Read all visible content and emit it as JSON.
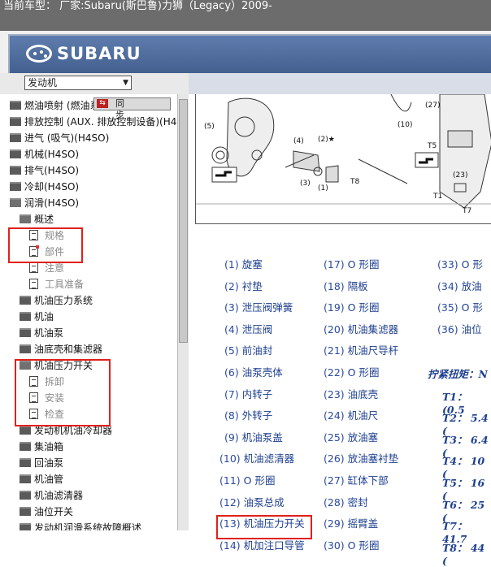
{
  "header": {
    "text": "当前车型：  厂家:Subaru(斯巴鲁)力狮（Legacy）2009-"
  },
  "banner": {
    "logo_text": "SUBARU"
  },
  "left": {
    "select_value": "发动机",
    "sync_label": "同 步",
    "tree": [
      {
        "label": "燃油喷射 (燃油系统)(H4SO)",
        "type": "folder",
        "indent": 0
      },
      {
        "label": "排放控制 (AUX. 排放控制设备)(H4SO)",
        "type": "folder",
        "indent": 0
      },
      {
        "label": "进气 (吸气)(H4SO)",
        "type": "folder",
        "indent": 0
      },
      {
        "label": "机械(H4SO)",
        "type": "folder",
        "indent": 0
      },
      {
        "label": "排气(H4SO)",
        "type": "folder",
        "indent": 0
      },
      {
        "label": "冷却(H4SO)",
        "type": "folder",
        "indent": 0
      },
      {
        "label": "润滑(H4SO)",
        "type": "folder-open",
        "indent": 0
      },
      {
        "label": "概述",
        "type": "folder-open",
        "indent": 1
      },
      {
        "label": "规格",
        "type": "doc",
        "indent": 2
      },
      {
        "label": "部件",
        "type": "doc-red",
        "indent": 2
      },
      {
        "label": "注意",
        "type": "doc",
        "indent": 2
      },
      {
        "label": "工具准备",
        "type": "doc",
        "indent": 2
      },
      {
        "label": "机油压力系统",
        "type": "folder",
        "indent": 1
      },
      {
        "label": "机油",
        "type": "folder",
        "indent": 1
      },
      {
        "label": "机油泵",
        "type": "folder",
        "indent": 1
      },
      {
        "label": "油底壳和集滤器",
        "type": "folder",
        "indent": 1
      },
      {
        "label": "机油压力开关",
        "type": "folder-open",
        "indent": 1
      },
      {
        "label": "拆卸",
        "type": "doc",
        "indent": 2
      },
      {
        "label": "安装",
        "type": "doc",
        "indent": 2
      },
      {
        "label": "检查",
        "type": "doc",
        "indent": 2
      },
      {
        "label": "发动机机油冷却器",
        "type": "folder",
        "indent": 1
      },
      {
        "label": "集油箱",
        "type": "folder",
        "indent": 1
      },
      {
        "label": "回油泵",
        "type": "folder",
        "indent": 1
      },
      {
        "label": "机油管",
        "type": "folder",
        "indent": 1
      },
      {
        "label": "机油滤清器",
        "type": "folder",
        "indent": 1
      },
      {
        "label": "油位开关",
        "type": "folder",
        "indent": 1
      },
      {
        "label": "发动机润滑系统故障概述",
        "type": "folder",
        "indent": 1
      }
    ]
  },
  "diagram": {
    "labels": [
      "(5)",
      "(4)",
      "(2)★",
      "(3)",
      "(1)",
      "T8",
      "(10)",
      "(27)",
      "T5",
      "(23)",
      "T1",
      "T7"
    ]
  },
  "legend": {
    "col1": [
      {
        "n": "(1)",
        "t": "旋塞"
      },
      {
        "n": "(2)",
        "t": "衬垫"
      },
      {
        "n": "(3)",
        "t": "泄压阀弹簧"
      },
      {
        "n": "(4)",
        "t": "泄压阀"
      },
      {
        "n": "(5)",
        "t": "前油封"
      },
      {
        "n": "(6)",
        "t": "油泵壳体"
      },
      {
        "n": "(7)",
        "t": "内转子"
      },
      {
        "n": "(8)",
        "t": "外转子"
      },
      {
        "n": "(9)",
        "t": "机油泵盖"
      },
      {
        "n": "(10)",
        "t": "机油滤清器"
      },
      {
        "n": "(11)",
        "t": "O 形圈"
      },
      {
        "n": "(12)",
        "t": "油泵总成"
      },
      {
        "n": "(13)",
        "t": "机油压力开关"
      },
      {
        "n": "(14)",
        "t": "机加注口导管"
      }
    ],
    "col2": [
      {
        "n": "(17)",
        "t": "O 形圈"
      },
      {
        "n": "(18)",
        "t": "隔板"
      },
      {
        "n": "(19)",
        "t": "O 形圈"
      },
      {
        "n": "(20)",
        "t": "机油集滤器"
      },
      {
        "n": "(21)",
        "t": "机油尺导杆"
      },
      {
        "n": "(22)",
        "t": "O 形圈"
      },
      {
        "n": "(23)",
        "t": "油底壳"
      },
      {
        "n": "(24)",
        "t": "机油尺"
      },
      {
        "n": "(25)",
        "t": "放油塞"
      },
      {
        "n": "(26)",
        "t": "放油塞衬垫"
      },
      {
        "n": "(27)",
        "t": "缸体下部"
      },
      {
        "n": "(28)",
        "t": "密封"
      },
      {
        "n": "(29)",
        "t": "摇臂盖"
      },
      {
        "n": "(30)",
        "t": "O 形圈"
      }
    ],
    "col3": [
      {
        "n": "(33)",
        "t": "O 形"
      },
      {
        "n": "(34)",
        "t": "放油"
      },
      {
        "n": "(35)",
        "t": "O 形"
      },
      {
        "n": "(36)",
        "t": "油位"
      }
    ],
    "torque_title": "拧紧扭矩：N",
    "torque": [
      {
        "k": "T1：",
        "v": "(0.5"
      },
      {
        "k": "T2：",
        "v": "5.4 ("
      },
      {
        "k": "T3：",
        "v": "6.4 ("
      },
      {
        "k": "T4：",
        "v": "10 ("
      },
      {
        "k": "T5：",
        "v": "16 ("
      },
      {
        "k": "T6：",
        "v": "25 ("
      },
      {
        "k": "T7：",
        "v": "41.7"
      },
      {
        "k": "T8：",
        "v": "44 ("
      }
    ]
  },
  "colors": {
    "highlight": "#e0201a",
    "link": "#1d3f8f",
    "banner": "#4d6a99"
  }
}
